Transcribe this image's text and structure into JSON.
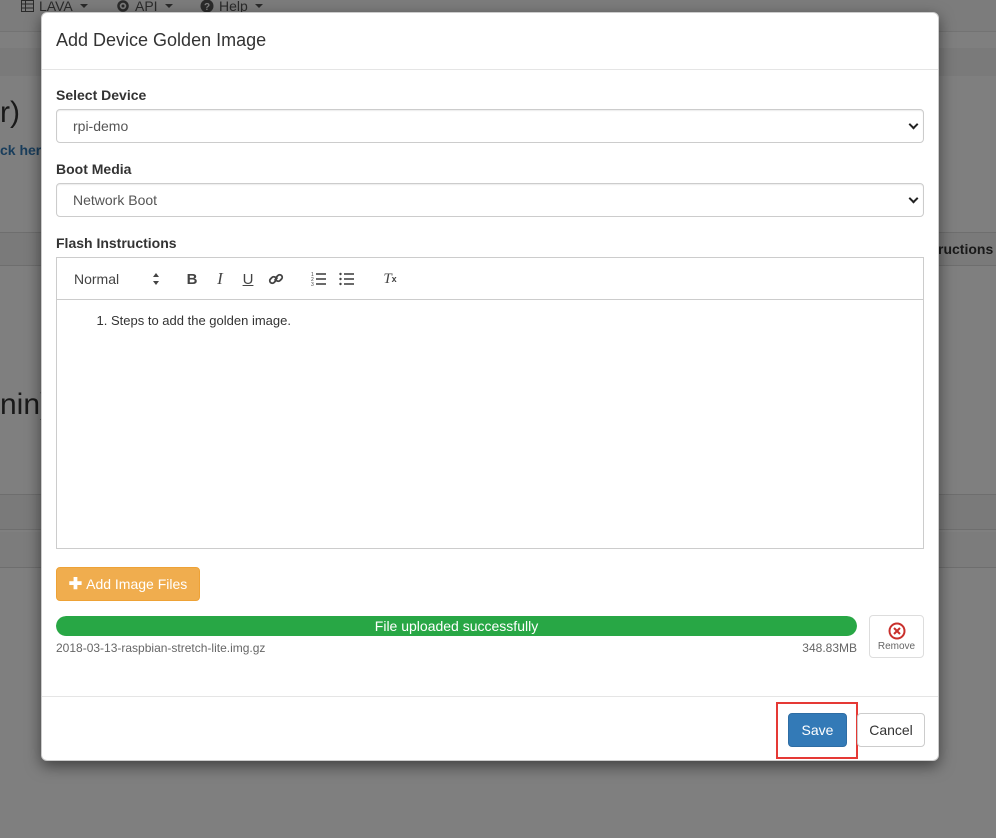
{
  "background": {
    "nav_items": [
      {
        "label": "LAVA",
        "icon": "table-icon"
      },
      {
        "label": "API",
        "icon": "gear-icon"
      },
      {
        "label": "Help",
        "icon": "question-circle-icon"
      }
    ],
    "heading_fragment_1": "r)",
    "link_fragment": "ck her",
    "column_fragment": "ructions",
    "heading_fragment_2": "nin)"
  },
  "modal": {
    "title": "Add Device Golden Image",
    "device_label": "Select Device",
    "device_value": "rpi-demo",
    "boot_label": "Boot Media",
    "boot_value": "Network Boot",
    "flash_label": "Flash Instructions",
    "editor": {
      "format_value": "Normal",
      "toolbar_icons": [
        "bold-icon",
        "italic-icon",
        "underline-icon",
        "link-icon",
        "ordered-list-icon",
        "bullet-list-icon",
        "clear-format-icon"
      ],
      "content_items": [
        "Steps to add the golden image."
      ]
    },
    "add_files_label": "Add Image Files",
    "upload": {
      "status": "File uploaded successfully",
      "progress_percent": 100,
      "file_name": "2018-03-13-raspbian-stretch-lite.img.gz",
      "file_size": "348.83MB",
      "remove_label": "Remove"
    },
    "save_label": "Save",
    "cancel_label": "Cancel"
  },
  "colors": {
    "primary": "#337ab7",
    "warning": "#f0ad4e",
    "success": "#28a745",
    "danger": "#c9302c",
    "highlight": "#e53935"
  }
}
